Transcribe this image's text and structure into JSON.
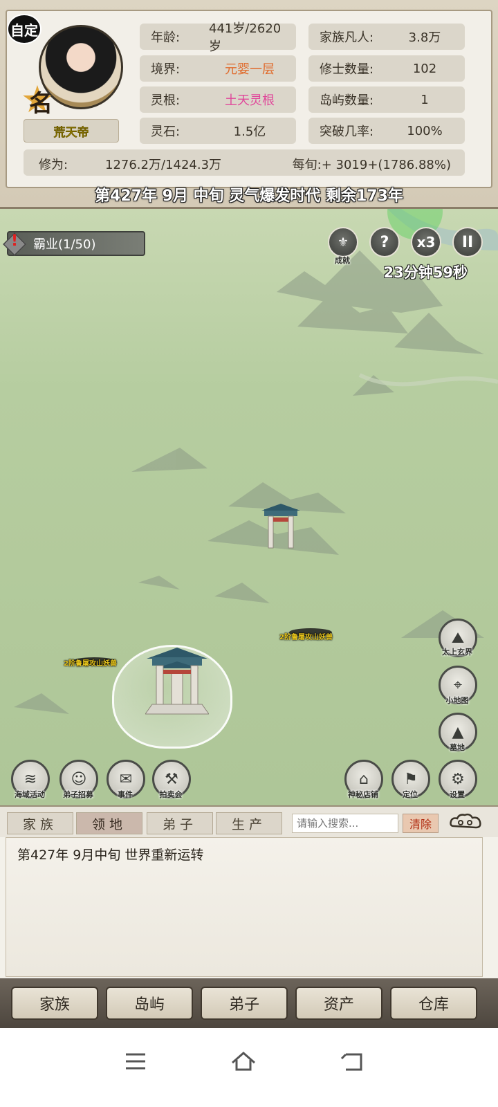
{
  "header": {
    "custom_badge": "自定",
    "rank_char": "名",
    "player_name": "荒天帝",
    "stats": {
      "age_label": "年龄:",
      "age_value": "441岁/2620岁",
      "realm_label": "境界:",
      "realm_value": "元婴一层",
      "root_label": "灵根:",
      "root_value": "土天灵根",
      "stone_label": "灵石:",
      "stone_value": "1.5亿",
      "mortals_label": "家族凡人:",
      "mortals_value": "3.8万",
      "cultivators_label": "修士数量:",
      "cultivators_value": "102",
      "islands_label": "岛屿数量:",
      "islands_value": "1",
      "breakthrough_label": "突破几率:",
      "breakthrough_value": "100%"
    },
    "xiuwei": {
      "label": "修为:",
      "value": "1276.2万/1424.3万",
      "per_turn": "每旬:+ 3019+(1786.88%)"
    },
    "year_banner": "第427年 9月 中旬  灵气爆发时代 剩余173年"
  },
  "map": {
    "quest": "霸业(1/50)",
    "speed": "x3",
    "help": "?",
    "pause": "II",
    "achievement_label": "成就",
    "timer": "23分钟59秒",
    "beasts": [
      {
        "label": "2阶鲁屠攻山妖兽"
      },
      {
        "label": "2阶鲁屠攻山妖兽"
      }
    ],
    "left_buttons": [
      {
        "label": "海域活动"
      },
      {
        "label": "弟子招募"
      },
      {
        "label": "事件"
      },
      {
        "label": "拍卖会"
      }
    ],
    "right_buttons": [
      {
        "label": "太上玄界"
      },
      {
        "label": "小地图"
      },
      {
        "label": "墓地"
      }
    ],
    "bottom_right_buttons": [
      {
        "label": "神秘店铺"
      },
      {
        "label": "定位"
      },
      {
        "label": "设置"
      }
    ]
  },
  "tabs": {
    "items": [
      {
        "label": "家族",
        "active": false
      },
      {
        "label": "领地",
        "active": true
      },
      {
        "label": "弟子",
        "active": false
      },
      {
        "label": "生产",
        "active": false
      }
    ],
    "search_placeholder": "请输入搜索...",
    "clear": "清除"
  },
  "log": {
    "lines": [
      "第427年   9月中旬 世界重新运转"
    ]
  },
  "bottom_nav": {
    "items": [
      {
        "label": "家族"
      },
      {
        "label": "岛屿"
      },
      {
        "label": "弟子"
      },
      {
        "label": "资产"
      },
      {
        "label": "仓库"
      }
    ]
  },
  "colors": {
    "realm": "#e06a2b",
    "root": "#e0479a",
    "name": "#c9a800",
    "clear_text": "#b02b10"
  }
}
